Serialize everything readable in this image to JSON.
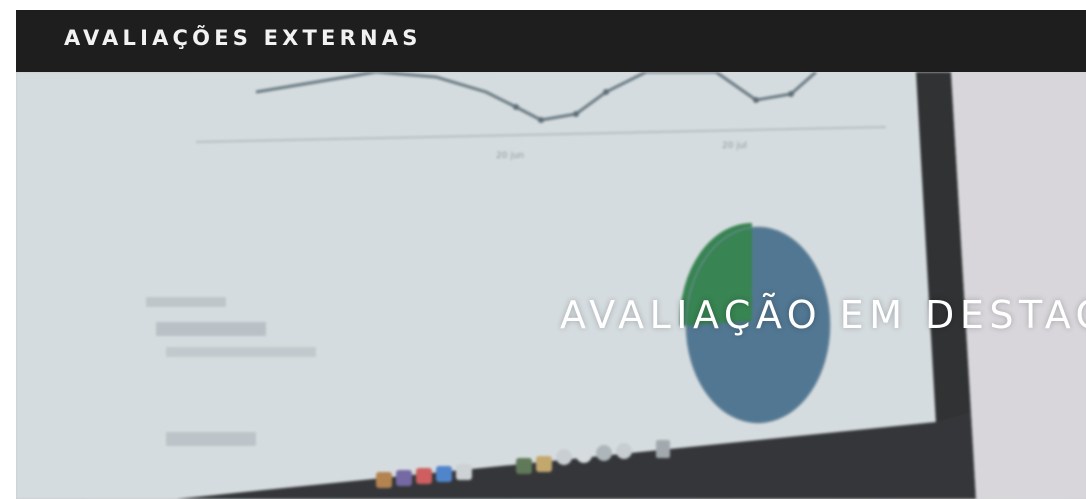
{
  "header": {
    "title": "AVALIAÇÕES EXTERNAS"
  },
  "hero": {
    "heading": "AVALIAÇÃO EM DESTAQUE",
    "background_image": "blurred laptop screen showing a line chart and a pie chart",
    "colors": {
      "pie_green": "#1f7a3c",
      "pie_blue": "#3f6b8a",
      "screen": "#dfe6e8",
      "bezel": "#141516"
    }
  },
  "colors": {
    "topbar_bg": "#1f1e1e",
    "topbar_text": "#f2f2f2",
    "heading_text": "#ffffff"
  }
}
